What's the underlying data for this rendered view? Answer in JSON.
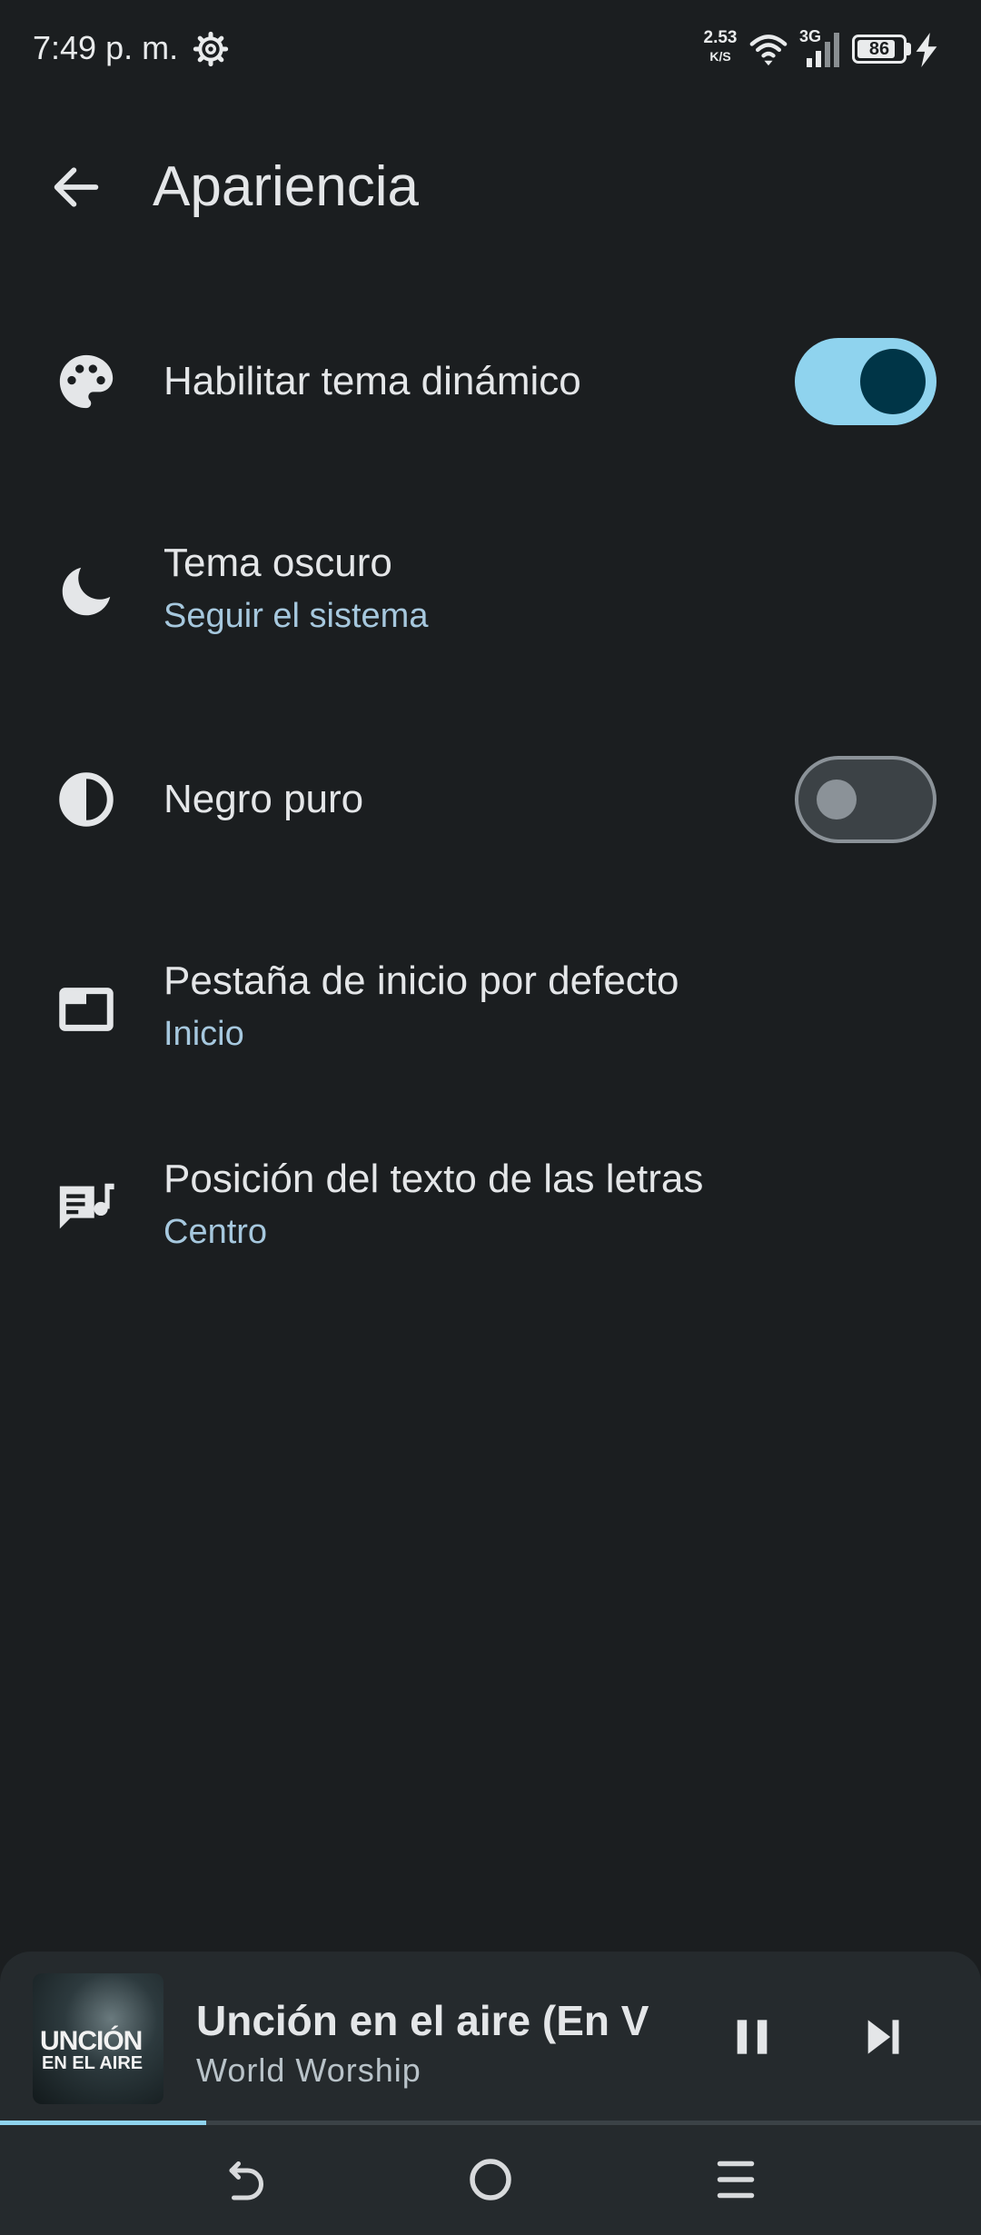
{
  "status_bar": {
    "time": "7:49 p. m.",
    "net_speed_value": "2.53",
    "net_speed_unit": "K/S",
    "network_type": "3G",
    "battery_level": "86",
    "icons": [
      "settings-gear-icon",
      "wifi-icon",
      "signal-icon",
      "battery-icon",
      "charging-icon"
    ]
  },
  "header": {
    "title": "Apariencia",
    "back_icon": "arrow-back-icon"
  },
  "settings": [
    {
      "id": "dynamic-theme",
      "icon": "palette-icon",
      "label": "Habilitar tema dinámico",
      "toggle": true
    },
    {
      "id": "dark-theme",
      "icon": "moon-icon",
      "label": "Tema oscuro",
      "value": "Seguir el sistema"
    },
    {
      "id": "pure-black",
      "icon": "contrast-icon",
      "label": "Negro puro",
      "toggle": false
    },
    {
      "id": "default-tab",
      "icon": "tab-icon",
      "label": "Pestaña de inicio por defecto",
      "value": "Inicio"
    },
    {
      "id": "lyrics-position",
      "icon": "lyrics-icon",
      "label": "Posición del texto de las letras",
      "value": "Centro"
    }
  ],
  "player": {
    "title": "Unción en el aire (En V",
    "artist": "World Worship",
    "artwork_text_line1": "UNCIÓN",
    "artwork_text_line2": "EN EL AIRE",
    "progress_fraction": 0.21
  },
  "colors": {
    "background": "#1b1e20",
    "accent": "#8fd3ee",
    "subtitle": "#a6c8de",
    "player_bg": "#252a2d"
  }
}
